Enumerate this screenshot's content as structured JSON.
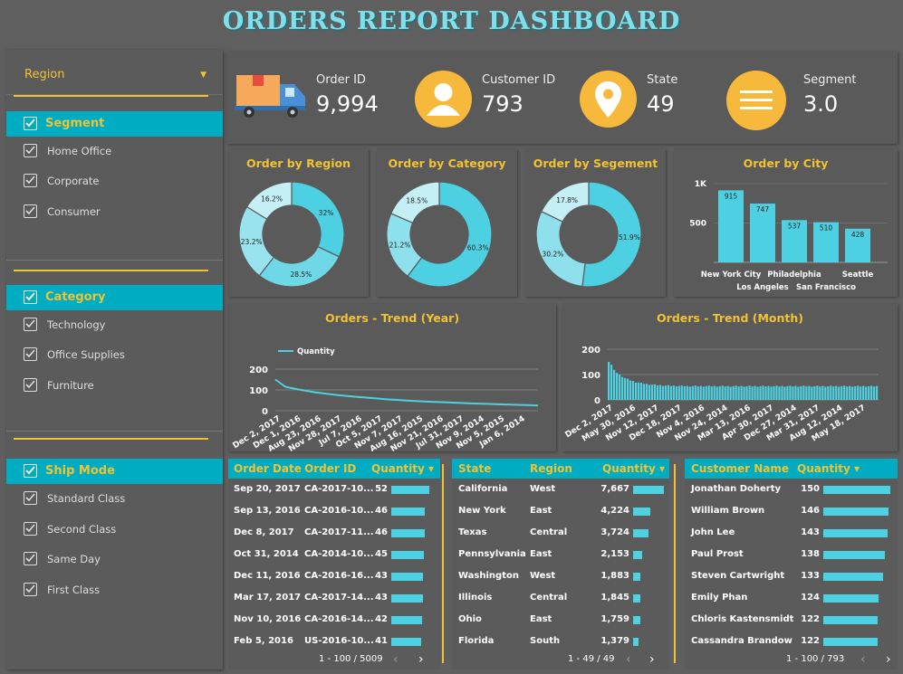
{
  "title": "ORDERS REPORT DASHBOARD",
  "colors": {
    "accent": "#00acc1",
    "gold": "#f1c232",
    "bar": "#4dd0e1",
    "bg": "#5f5f5f"
  },
  "sidebar": {
    "region_label": "Region",
    "groups": [
      {
        "label": "Segment",
        "items": [
          "Home Office",
          "Corporate",
          "Consumer"
        ]
      },
      {
        "label": "Category",
        "items": [
          "Technology",
          "Office Supplies",
          "Furniture"
        ]
      },
      {
        "label": "Ship Mode",
        "items": [
          "Standard Class",
          "Second Class",
          "Same Day",
          "First Class"
        ]
      }
    ]
  },
  "kpis": [
    {
      "label": "Order ID",
      "value": "9,994",
      "icon": "truck-icon"
    },
    {
      "label": "Customer ID",
      "value": "793",
      "icon": "user-icon"
    },
    {
      "label": "State",
      "value": "49",
      "icon": "location-pin-icon"
    },
    {
      "label": "Segment",
      "value": "3.0",
      "icon": "menu-lines-icon"
    }
  ],
  "chart_data": [
    {
      "type": "pie",
      "title": "Order by Region",
      "donut": true,
      "values": [
        32,
        28.5,
        23.2,
        16.2
      ],
      "labels": [
        "32%",
        "28.5%",
        "23.2%",
        "16.2%"
      ],
      "colors": [
        "#4dd0e1",
        "#6fd8e7",
        "#98e3ee",
        "#c4eff5"
      ]
    },
    {
      "type": "pie",
      "title": "Order by Category",
      "donut": true,
      "values": [
        60.3,
        21.2,
        18.5
      ],
      "labels": [
        "60.3%",
        "21.2%",
        "18.5%"
      ],
      "colors": [
        "#4dd0e1",
        "#8ee0ec",
        "#c4eff5"
      ]
    },
    {
      "type": "pie",
      "title": "Order by Segement",
      "donut": true,
      "values": [
        51.9,
        30.2,
        17.8
      ],
      "labels": [
        "51.9%",
        "30.2%",
        "17.8%"
      ],
      "colors": [
        "#4dd0e1",
        "#8ee0ec",
        "#c4eff5"
      ]
    },
    {
      "type": "bar",
      "title": "Order by City",
      "categories": [
        "New York City",
        "Los Angeles",
        "Philadelphia",
        "San Francisco",
        "Seattle"
      ],
      "values": [
        915,
        747,
        537,
        510,
        428
      ],
      "value_labels": [
        "915",
        "747",
        "537",
        "510",
        "428"
      ],
      "yticks": [
        "1K",
        "500"
      ],
      "ylim": [
        0,
        1000
      ]
    },
    {
      "type": "line",
      "title": "Orders - Trend (Year)",
      "legend": "Quantity",
      "yticks": [
        "200",
        "100",
        "0"
      ],
      "ylim": [
        0,
        200
      ],
      "xticks": [
        "Dec 2, 2017",
        "Dec 1, 2016",
        "Aug 23, 2016",
        "Nov 28, 2017",
        "Jul 7, 2016",
        "Oct 5, 2017",
        "Nov 7, 2017",
        "Aug 16, 2015",
        "Nov 21, 2016",
        "Jul 31, 2017",
        "Nov 9, 2014",
        "Nov 5, 2015",
        "Jan 6, 2014"
      ],
      "y": [
        150,
        115,
        105,
        96,
        88,
        82,
        76,
        71,
        67,
        63,
        59,
        55,
        52,
        49,
        46,
        44,
        42,
        40,
        38,
        36,
        34,
        33,
        31,
        30,
        28,
        27,
        25
      ]
    },
    {
      "type": "bar",
      "title": "Orders - Trend (Month)",
      "yticks": [
        "200",
        "100",
        "0"
      ],
      "ylim": [
        0,
        200
      ],
      "xticks": [
        "Dec 2, 2017",
        "May 30, 2016",
        "Nov 12, 2017",
        "Dec 18, 2017",
        "Nov 4, 2016",
        "Nov 24, 2014",
        "Mar 13, 2016",
        "Apr 30, 2017",
        "Dec 27, 2014",
        "Mar 31, 2017",
        "Aug 12, 2014",
        "May 18, 2017"
      ],
      "max": 150,
      "min": 52
    }
  ],
  "tables": [
    {
      "headers": [
        "Order Date",
        "Order ID",
        "Quantity"
      ],
      "rows": [
        [
          "Sep 20, 2017",
          "CA-2017-10...",
          "52"
        ],
        [
          "Sep 13, 2016",
          "CA-2016-10...",
          "46"
        ],
        [
          "Dec 8, 2017",
          "CA-2017-11...",
          "46"
        ],
        [
          "Oct 31, 2014",
          "CA-2014-10...",
          "45"
        ],
        [
          "Dec 11, 2016",
          "CA-2016-16...",
          "43"
        ],
        [
          "Mar 17, 2017",
          "CA-2017-14...",
          "43"
        ],
        [
          "Nov 10, 2016",
          "CA-2016-14...",
          "42"
        ],
        [
          "Feb 5, 2016",
          "US-2016-10...",
          "41"
        ]
      ],
      "bar_values": [
        52,
        46,
        46,
        45,
        43,
        43,
        42,
        41
      ],
      "bar_max": 52,
      "pager": "1 - 100 / 5009"
    },
    {
      "headers": [
        "State",
        "Region",
        "Quantity"
      ],
      "rows": [
        [
          "California",
          "West",
          "7,667"
        ],
        [
          "New York",
          "East",
          "4,224"
        ],
        [
          "Texas",
          "Central",
          "3,724"
        ],
        [
          "Pennsylvania",
          "East",
          "2,153"
        ],
        [
          "Washington",
          "West",
          "1,883"
        ],
        [
          "Illinois",
          "Central",
          "1,845"
        ],
        [
          "Ohio",
          "East",
          "1,759"
        ],
        [
          "Florida",
          "South",
          "1,379"
        ]
      ],
      "bar_values": [
        7667,
        4224,
        3724,
        2153,
        1883,
        1845,
        1759,
        1379
      ],
      "bar_max": 7667,
      "pager": "1 - 49 / 49"
    },
    {
      "headers": [
        "Customer Name",
        "Quantity"
      ],
      "rows": [
        [
          "Jonathan Doherty",
          "150"
        ],
        [
          "William Brown",
          "146"
        ],
        [
          "John Lee",
          "143"
        ],
        [
          "Paul Prost",
          "138"
        ],
        [
          "Steven Cartwright",
          "133"
        ],
        [
          "Emily Phan",
          "124"
        ],
        [
          "Chloris Kastensmidt",
          "122"
        ],
        [
          "Cassandra Brandow",
          "122"
        ]
      ],
      "bar_values": [
        150,
        146,
        143,
        138,
        133,
        124,
        122,
        122
      ],
      "bar_max": 150,
      "pager": "1 - 100 / 793"
    }
  ]
}
